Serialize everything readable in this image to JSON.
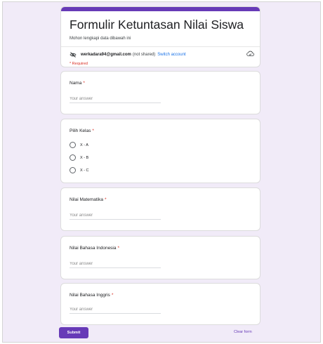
{
  "form": {
    "title": "Formulir Ketuntasan Nilai Siswa",
    "description": "Mohon lengkapi data dibawah ini",
    "account_email": "werkadara94@gmail.com",
    "account_note": "(not shared)",
    "switch_account": "Switch account",
    "required_note": "* Required",
    "eye_off_icon": "visibility-off-icon",
    "cloud_icon": "cloud-saved-icon",
    "accent_color": "#673ab7",
    "background_color": "#f1ebf8"
  },
  "questions": {
    "nama": {
      "label": "Nama",
      "required_mark": "*",
      "placeholder": "Your answer"
    },
    "kelas": {
      "label": "Pilih Kelas",
      "required_mark": "*",
      "options": [
        "X - A",
        "X - B",
        "X - C"
      ]
    },
    "matematika": {
      "label": "Nilai Matematika",
      "required_mark": "*",
      "placeholder": "Your answer"
    },
    "indonesia": {
      "label": "Nilai Bahasa Indonesia",
      "required_mark": "*",
      "placeholder": "Your answer"
    },
    "inggris": {
      "label": "Nilai Bahasa Inggris",
      "required_mark": "*",
      "placeholder": "Your answer"
    }
  },
  "footer": {
    "submit_label": "Submit",
    "clear_label": "Clear form"
  }
}
